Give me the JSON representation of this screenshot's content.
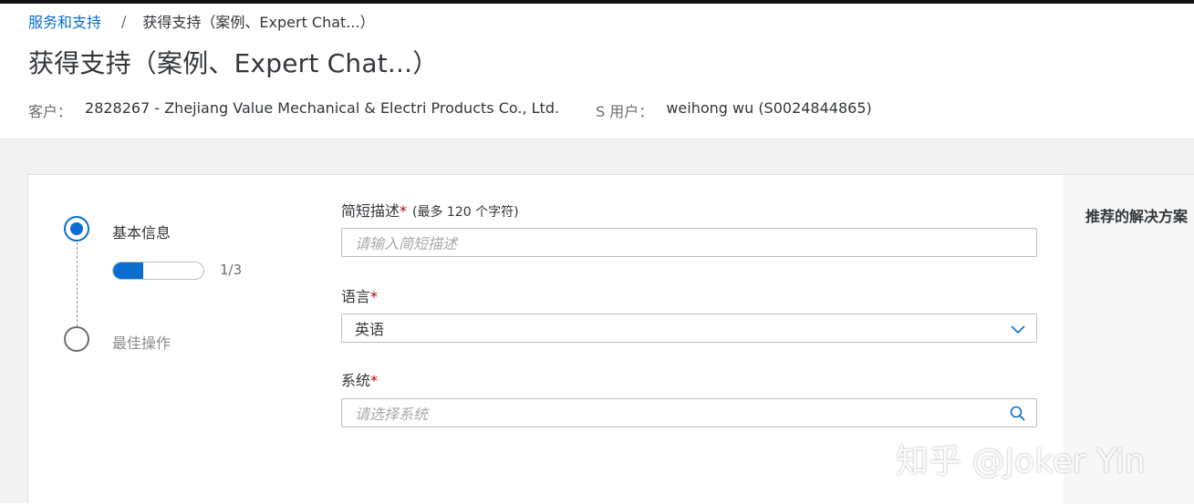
{
  "breadcrumb": {
    "parent": "服务和支持",
    "separator": "/",
    "current": "获得支持（案例、Expert Chat...）"
  },
  "page": {
    "title": "获得支持（案例、Expert Chat...）"
  },
  "meta": {
    "customer_label": "客户：",
    "customer_value": "2828267 - Zhejiang Value Mechanical & Electri Products Co., Ltd.",
    "suser_label": "S 用户：",
    "suser_value": "weihong wu (S0024844865)"
  },
  "steps": {
    "items": [
      {
        "label": "基本信息",
        "state": "active"
      },
      {
        "label": "最佳操作",
        "state": "inactive"
      }
    ],
    "progress": {
      "text": "1/3",
      "fraction": 0.33
    }
  },
  "form": {
    "short_desc": {
      "label": "简短描述",
      "required": "*",
      "hint": "(最多 120 个字符)",
      "placeholder": "请输入简短描述"
    },
    "language": {
      "label": "语言",
      "required": "*",
      "value": "英语",
      "icon": "chevron-down-icon"
    },
    "system": {
      "label": "系统",
      "required": "*",
      "placeholder": "请选择系统",
      "icon": "search-icon"
    }
  },
  "recommendations": {
    "title": "推荐的解决方案"
  },
  "watermark": "知乎 @Joker Yin",
  "colors": {
    "accent": "#0a6ed1",
    "required": "#bb0000",
    "background": "#f2f2f2"
  }
}
